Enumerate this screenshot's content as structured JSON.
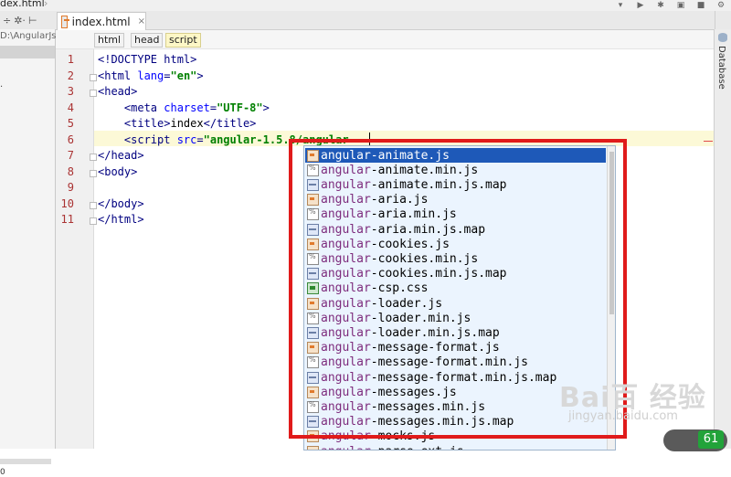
{
  "top": {
    "crumb": "dex.html"
  },
  "tab": {
    "label": "index.html",
    "close": "×"
  },
  "project": {
    "path": "D:\\AngularJs",
    "bottom_text": "0"
  },
  "breadcrumb": [
    {
      "label": "html"
    },
    {
      "label": "head"
    },
    {
      "label": "script"
    }
  ],
  "lines": [
    {
      "n": "1",
      "parts": [
        [
          "tag",
          "<!DOCTYPE html>"
        ]
      ]
    },
    {
      "n": "2",
      "parts": [
        [
          "tag",
          "<html "
        ],
        [
          "attr",
          "lang"
        ],
        [
          "tag",
          "="
        ],
        [
          "str",
          "\"en\""
        ],
        [
          "tag",
          ">"
        ]
      ]
    },
    {
      "n": "3",
      "parts": [
        [
          "tag",
          "<head>"
        ]
      ]
    },
    {
      "n": "4",
      "parts": [
        [
          "tag",
          "    <meta "
        ],
        [
          "attr",
          "charset"
        ],
        [
          "tag",
          "="
        ],
        [
          "str",
          "\"UTF-8\""
        ],
        [
          "tag",
          ">"
        ]
      ]
    },
    {
      "n": "5",
      "parts": [
        [
          "tag",
          "    <title>"
        ],
        [
          "plain",
          "index"
        ],
        [
          "tag",
          "</title>"
        ]
      ]
    },
    {
      "n": "6",
      "parts": [
        [
          "tag",
          "    <script "
        ],
        [
          "attr",
          "src"
        ],
        [
          "tag",
          "="
        ],
        [
          "str",
          "\"angular-1.5.8/angular"
        ]
      ]
    },
    {
      "n": "7",
      "parts": [
        [
          "tag",
          "</head>"
        ]
      ]
    },
    {
      "n": "8",
      "parts": [
        [
          "tag",
          "<body>"
        ]
      ]
    },
    {
      "n": "9",
      "parts": []
    },
    {
      "n": "10",
      "parts": [
        [
          "tag",
          "</body>"
        ]
      ]
    },
    {
      "n": "11",
      "parts": [
        [
          "tag",
          "</html>"
        ]
      ]
    }
  ],
  "completion": {
    "prefix": "angular",
    "items": [
      {
        "suffix": "-animate.js",
        "kind": "js",
        "selected": true
      },
      {
        "suffix": "-animate.min.js",
        "kind": "min"
      },
      {
        "suffix": "-animate.min.js.map",
        "kind": "map"
      },
      {
        "suffix": "-aria.js",
        "kind": "js"
      },
      {
        "suffix": "-aria.min.js",
        "kind": "min"
      },
      {
        "suffix": "-aria.min.js.map",
        "kind": "map"
      },
      {
        "suffix": "-cookies.js",
        "kind": "js"
      },
      {
        "suffix": "-cookies.min.js",
        "kind": "min"
      },
      {
        "suffix": "-cookies.min.js.map",
        "kind": "map"
      },
      {
        "suffix": "-csp.css",
        "kind": "css"
      },
      {
        "suffix": "-loader.js",
        "kind": "js"
      },
      {
        "suffix": "-loader.min.js",
        "kind": "min"
      },
      {
        "suffix": "-loader.min.js.map",
        "kind": "map"
      },
      {
        "suffix": "-message-format.js",
        "kind": "js"
      },
      {
        "suffix": "-message-format.min.js",
        "kind": "min"
      },
      {
        "suffix": "-message-format.min.js.map",
        "kind": "map"
      },
      {
        "suffix": "-messages.js",
        "kind": "js"
      },
      {
        "suffix": "-messages.min.js",
        "kind": "min"
      },
      {
        "suffix": "-messages.min.js.map",
        "kind": "map"
      },
      {
        "suffix": "-mocks.js",
        "kind": "js"
      },
      {
        "suffix": "-parse-ext.js",
        "kind": "js"
      }
    ]
  },
  "right_strip": {
    "label": "Database"
  },
  "watermark": {
    "main": "Bai百 经验",
    "sub": "jingyan.baidu.com"
  },
  "badge": {
    "pct": "61"
  },
  "colors": {
    "selection": "#1e59b8",
    "annotation": "#e01b1b",
    "popup_bg": "#ebf4fe"
  }
}
